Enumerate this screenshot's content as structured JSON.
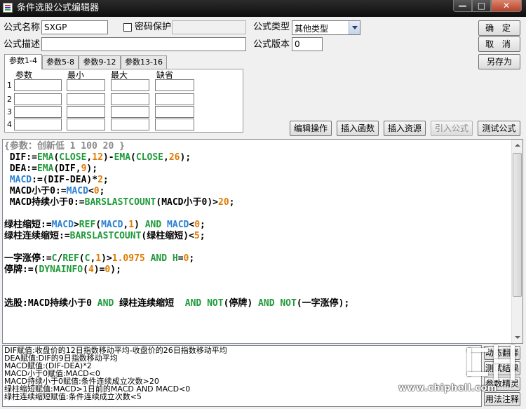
{
  "window": {
    "title": "条件选股公式编辑器",
    "minimize_glyph": "—",
    "maximize_glyph": "□",
    "close_glyph": "✕",
    "icon": "formula-app-icon"
  },
  "form": {
    "name_label": "公式名称",
    "name_value": "SXGP",
    "password_label": "密码保护",
    "password_checked": false,
    "password_value": "",
    "type_label": "公式类型",
    "type_value": "其他类型",
    "desc_label": "公式描述",
    "desc_value": "",
    "version_label": "公式版本",
    "version_value": "0"
  },
  "buttons": {
    "ok": "确  定",
    "cancel": "取  消",
    "save_as": "另存为",
    "edit_op": "编辑操作",
    "insert_fn": "插入函数",
    "insert_res": "插入资源",
    "import": "引入公式",
    "test": "测试公式"
  },
  "tabs": [
    {
      "label": "参数1-4",
      "active": true
    },
    {
      "label": "参数5-8",
      "active": false
    },
    {
      "label": "参数9-12",
      "active": false
    },
    {
      "label": "参数13-16",
      "active": false
    }
  ],
  "params": {
    "headers": [
      "参数",
      "最小",
      "最大",
      "缺省"
    ],
    "rows": [
      "1",
      "2",
      "3",
      "4"
    ]
  },
  "code_lines": [
    [
      [
        "k-comment",
        "{参数：创新低 1 100 20 }"
      ]
    ],
    [
      [
        "k-dk",
        " DIF:="
      ],
      [
        "k-fn",
        "EMA"
      ],
      [
        "k-dk",
        "("
      ],
      [
        "k-fn",
        "CLOSE"
      ],
      [
        "k-dk",
        ","
      ],
      [
        "k-num",
        "12"
      ],
      [
        "k-dk",
        ")-"
      ],
      [
        "k-fn",
        "EMA"
      ],
      [
        "k-dk",
        "("
      ],
      [
        "k-fn",
        "CLOSE"
      ],
      [
        "k-dk",
        ","
      ],
      [
        "k-num",
        "26"
      ],
      [
        "k-dk",
        ");"
      ]
    ],
    [
      [
        "k-dk",
        " DEA:="
      ],
      [
        "k-fn",
        "EMA"
      ],
      [
        "k-dk",
        "(DIF,"
      ],
      [
        "k-num",
        "9"
      ],
      [
        "k-dk",
        ");"
      ]
    ],
    [
      [
        "k-dk",
        " "
      ],
      [
        "k-var",
        "MACD"
      ],
      [
        "k-dk",
        ":=(DIF-DEA)*"
      ],
      [
        "k-num",
        "2"
      ],
      [
        "k-dk",
        ";"
      ]
    ],
    [
      [
        "k-dk",
        " MACD小于0:="
      ],
      [
        "k-var",
        "MACD"
      ],
      [
        "k-dk",
        "<"
      ],
      [
        "k-num",
        "0"
      ],
      [
        "k-dk",
        ";"
      ]
    ],
    [
      [
        "k-dk",
        " MACD持续小于0:="
      ],
      [
        "k-fn",
        "BARSLASTCOUNT"
      ],
      [
        "k-dk",
        "(MACD小于0)>"
      ],
      [
        "k-num",
        "20"
      ],
      [
        "k-dk",
        ";"
      ]
    ],
    [
      [
        "k-dk",
        ""
      ]
    ],
    [
      [
        "k-dk",
        "绿柱缩短:="
      ],
      [
        "k-var",
        "MACD"
      ],
      [
        "k-dk",
        ">"
      ],
      [
        "k-fn",
        "REF"
      ],
      [
        "k-dk",
        "("
      ],
      [
        "k-var",
        "MACD"
      ],
      [
        "k-dk",
        ","
      ],
      [
        "k-num",
        "1"
      ],
      [
        "k-dk",
        ") "
      ],
      [
        "k-kw",
        "AND"
      ],
      [
        "k-dk",
        " "
      ],
      [
        "k-var",
        "MACD"
      ],
      [
        "k-dk",
        "<"
      ],
      [
        "k-num",
        "0"
      ],
      [
        "k-dk",
        ";"
      ]
    ],
    [
      [
        "k-dk",
        "绿柱连续缩短:="
      ],
      [
        "k-fn",
        "BARSLASTCOUNT"
      ],
      [
        "k-dk",
        "(绿柱缩短)<"
      ],
      [
        "k-num",
        "5"
      ],
      [
        "k-dk",
        ";"
      ]
    ],
    [
      [
        "k-dk",
        ""
      ]
    ],
    [
      [
        "k-dk",
        "一字涨停:="
      ],
      [
        "k-fn",
        "C"
      ],
      [
        "k-dk",
        "/"
      ],
      [
        "k-fn",
        "REF"
      ],
      [
        "k-dk",
        "("
      ],
      [
        "k-fn",
        "C"
      ],
      [
        "k-dk",
        ","
      ],
      [
        "k-num",
        "1"
      ],
      [
        "k-dk",
        ")>"
      ],
      [
        "k-num",
        "1.0975"
      ],
      [
        "k-dk",
        " "
      ],
      [
        "k-kw",
        "AND"
      ],
      [
        "k-dk",
        " "
      ],
      [
        "k-fn",
        "H"
      ],
      [
        "k-dk",
        "="
      ],
      [
        "k-num",
        "0"
      ],
      [
        "k-dk",
        ";"
      ]
    ],
    [
      [
        "k-dk",
        "停牌:=("
      ],
      [
        "k-fn",
        "DYNAINFO"
      ],
      [
        "k-dk",
        "("
      ],
      [
        "k-num",
        "4"
      ],
      [
        "k-dk",
        ")="
      ],
      [
        "k-num",
        "0"
      ],
      [
        "k-dk",
        ");"
      ]
    ],
    [
      [
        "k-dk",
        ""
      ]
    ],
    [
      [
        "k-dk",
        ""
      ]
    ],
    [
      [
        "k-dk",
        "选股:MACD持续小于0 "
      ],
      [
        "k-kw",
        "AND"
      ],
      [
        "k-dk",
        " 绿柱连续缩短  "
      ],
      [
        "k-kw",
        "AND"
      ],
      [
        "k-dk",
        " "
      ],
      [
        "k-kw",
        "NOT"
      ],
      [
        "k-dk",
        "(停牌) "
      ],
      [
        "k-kw",
        "AND"
      ],
      [
        "k-dk",
        " "
      ],
      [
        "k-kw",
        "NOT"
      ],
      [
        "k-dk",
        "(一字涨停);"
      ]
    ]
  ],
  "description_lines": [
    "DIF赋值:收盘价的12日指数移动平均-收盘价的26日指数移动平均",
    "DEA赋值:DIF的9日指数移动平均",
    "MACD赋值:(DIF-DEA)*2",
    "MACD小于0赋值:MACD<0",
    "MACD持续小于0赋值:条件连续成立次数>20",
    "绿柱缩短赋值:MACD>1日前的MACD AND MACD<0",
    "绿柱连续缩短赋值:条件连续成立次数<5"
  ],
  "side_buttons": [
    "动态翻译",
    "测试结果",
    "参数精灵",
    "用法注释"
  ],
  "watermark": {
    "text": "www.chiphell.com",
    "logo": "chiphell-logo"
  }
}
